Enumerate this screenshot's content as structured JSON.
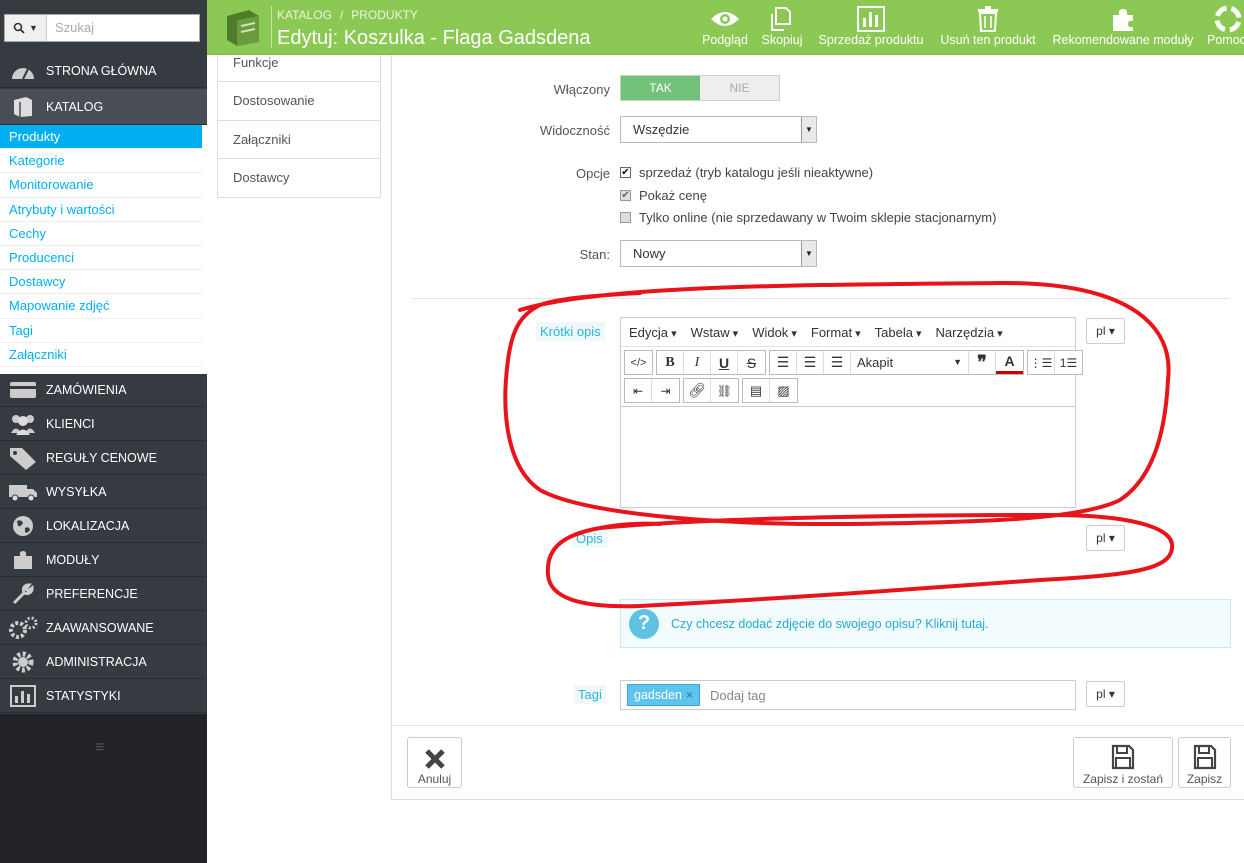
{
  "search": {
    "placeholder": "Szukaj"
  },
  "nav": {
    "home": "STRONA GŁÓWNA",
    "catalog": "KATALOG",
    "orders": "ZAMÓWIENIA",
    "customers": "KLIENCI",
    "price_rules": "REGUŁY CENOWE",
    "shipping": "WYSYŁKA",
    "localization": "LOKALIZACJA",
    "modules": "MODUŁY",
    "preferences": "PREFERENCJE",
    "advanced": "ZAAWANSOWANE",
    "administration": "ADMINISTRACJA",
    "stats": "STATYSTYKI"
  },
  "catalog_sub": [
    "Produkty",
    "Kategorie",
    "Monitorowanie",
    "Atrybuty i wartości",
    "Cechy",
    "Producenci",
    "Dostawcy",
    "Mapowanie zdjęć",
    "Tagi",
    "Załączniki"
  ],
  "header": {
    "crumb1": "KATALOG",
    "crumb_sep": "/",
    "crumb2": "PRODUKTY",
    "title": "Edytuj: Koszulka - Flaga Gadsdena",
    "preview": "Podgląd",
    "copy": "Skopiuj",
    "sales": "Sprzedaż produktu",
    "delete": "Usuń ten produkt",
    "recommended": "Rekomendowane moduły",
    "help": "Pomoc"
  },
  "tabs": [
    "Funkcje",
    "Dostosowanie",
    "Załączniki",
    "Dostawcy"
  ],
  "form": {
    "enabled_label": "Włączony",
    "yes": "TAK",
    "no": "NIE",
    "visibility_label": "Widoczność",
    "visibility_value": "Wszędzie",
    "options_label": "Opcje",
    "opt1": "sprzedaż (tryb katalogu jeśli nieaktywne)",
    "opt2": "Pokaż cenę",
    "opt3": "Tylko online (nie sprzedawany w Twoim sklepie stacjonarnym)",
    "condition_label": "Stan:",
    "condition_value": "Nowy",
    "short_desc_label": "Krótki opis",
    "desc_label": "Opis",
    "lang": "pl",
    "info": "Czy chcesz dodać zdjęcie do swojego opisu? Kliknij tutaj.",
    "tags_label": "Tagi",
    "tag1": "gadsden",
    "tag_placeholder": "Dodaj tag"
  },
  "editor": {
    "menu": [
      "Edycja",
      "Wstaw",
      "Widok",
      "Format",
      "Tabela",
      "Narzędzia"
    ],
    "format_select": "Akapit"
  },
  "footer": {
    "cancel": "Anuluj",
    "save_stay": "Zapisz i zostań",
    "save": "Zapisz"
  },
  "colors": {
    "header_green": "#8bc954",
    "accent_blue": "#00aff0",
    "annotation_red": "#e8141c"
  }
}
